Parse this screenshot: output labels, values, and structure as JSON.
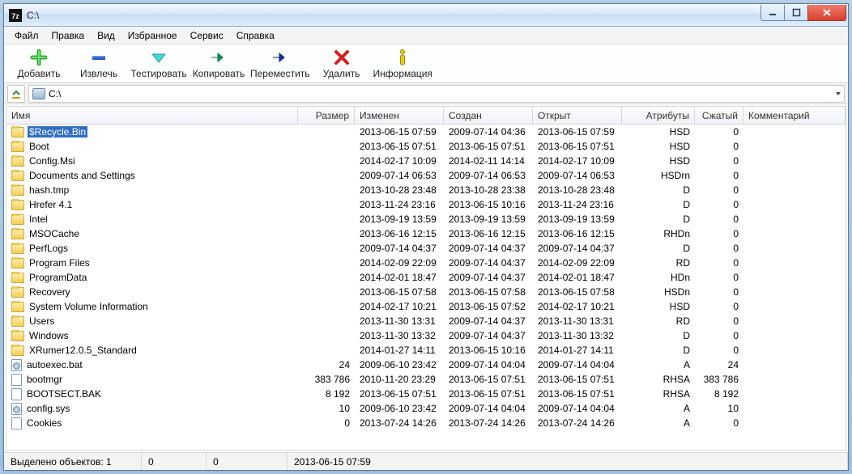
{
  "title": "C:\\",
  "menu": [
    "Файл",
    "Правка",
    "Вид",
    "Избранное",
    "Сервис",
    "Справка"
  ],
  "toolbar": [
    {
      "id": "add",
      "label": "Добавить"
    },
    {
      "id": "extract",
      "label": "Извлечь"
    },
    {
      "id": "test",
      "label": "Тестировать"
    },
    {
      "id": "copy",
      "label": "Копировать"
    },
    {
      "id": "move",
      "label": "Переместить"
    },
    {
      "id": "delete",
      "label": "Удалить"
    },
    {
      "id": "info",
      "label": "Информация"
    }
  ],
  "path": "C:\\",
  "columns": {
    "name": "Имя",
    "size": "Размер",
    "modified": "Изменен",
    "created": "Создан",
    "opened": "Открыт",
    "attr": "Атрибуты",
    "packed": "Сжатый",
    "comment": "Комментарий"
  },
  "rows": [
    {
      "t": "d",
      "sel": true,
      "n": "$Recycle.Bin",
      "s": "",
      "m": "2013-06-15 07:59",
      "c": "2009-07-14 04:36",
      "o": "2013-06-15 07:59",
      "a": "HSD",
      "p": "0"
    },
    {
      "t": "d",
      "n": "Boot",
      "s": "",
      "m": "2013-06-15 07:51",
      "c": "2013-06-15 07:51",
      "o": "2013-06-15 07:51",
      "a": "HSD",
      "p": "0"
    },
    {
      "t": "d",
      "n": "Config.Msi",
      "s": "",
      "m": "2014-02-17 10:09",
      "c": "2014-02-11 14:14",
      "o": "2014-02-17 10:09",
      "a": "HSD",
      "p": "0"
    },
    {
      "t": "d",
      "n": "Documents and Settings",
      "s": "",
      "m": "2009-07-14 06:53",
      "c": "2009-07-14 06:53",
      "o": "2009-07-14 06:53",
      "a": "HSDrn",
      "p": "0"
    },
    {
      "t": "d",
      "n": "hash.tmp",
      "s": "",
      "m": "2013-10-28 23:48",
      "c": "2013-10-28 23:38",
      "o": "2013-10-28 23:48",
      "a": "D",
      "p": "0"
    },
    {
      "t": "d",
      "n": "Hrefer 4.1",
      "s": "",
      "m": "2013-11-24 23:16",
      "c": "2013-06-15 10:16",
      "o": "2013-11-24 23:16",
      "a": "D",
      "p": "0"
    },
    {
      "t": "d",
      "n": "Intel",
      "s": "",
      "m": "2013-09-19 13:59",
      "c": "2013-09-19 13:59",
      "o": "2013-09-19 13:59",
      "a": "D",
      "p": "0"
    },
    {
      "t": "d",
      "n": "MSOCache",
      "s": "",
      "m": "2013-06-16 12:15",
      "c": "2013-06-16 12:15",
      "o": "2013-06-16 12:15",
      "a": "RHDn",
      "p": "0"
    },
    {
      "t": "d",
      "n": "PerfLogs",
      "s": "",
      "m": "2009-07-14 04:37",
      "c": "2009-07-14 04:37",
      "o": "2009-07-14 04:37",
      "a": "D",
      "p": "0"
    },
    {
      "t": "d",
      "n": "Program Files",
      "s": "",
      "m": "2014-02-09 22:09",
      "c": "2009-07-14 04:37",
      "o": "2014-02-09 22:09",
      "a": "RD",
      "p": "0"
    },
    {
      "t": "d",
      "n": "ProgramData",
      "s": "",
      "m": "2014-02-01 18:47",
      "c": "2009-07-14 04:37",
      "o": "2014-02-01 18:47",
      "a": "HDn",
      "p": "0"
    },
    {
      "t": "d",
      "n": "Recovery",
      "s": "",
      "m": "2013-06-15 07:58",
      "c": "2013-06-15 07:58",
      "o": "2013-06-15 07:58",
      "a": "HSDn",
      "p": "0"
    },
    {
      "t": "d",
      "n": "System Volume Information",
      "s": "",
      "m": "2014-02-17 10:21",
      "c": "2013-06-15 07:52",
      "o": "2014-02-17 10:21",
      "a": "HSD",
      "p": "0"
    },
    {
      "t": "d",
      "n": "Users",
      "s": "",
      "m": "2013-11-30 13:31",
      "c": "2009-07-14 04:37",
      "o": "2013-11-30 13:31",
      "a": "RD",
      "p": "0"
    },
    {
      "t": "d",
      "n": "Windows",
      "s": "",
      "m": "2013-11-30 13:32",
      "c": "2009-07-14 04:37",
      "o": "2013-11-30 13:32",
      "a": "D",
      "p": "0"
    },
    {
      "t": "d",
      "n": "XRumer12.0.5_Standard",
      "s": "",
      "m": "2014-01-27 14:11",
      "c": "2013-06-15 10:16",
      "o": "2014-01-27 14:11",
      "a": "D",
      "p": "0"
    },
    {
      "t": "fg",
      "n": "autoexec.bat",
      "s": "24",
      "m": "2009-06-10 23:42",
      "c": "2009-07-14 04:04",
      "o": "2009-07-14 04:04",
      "a": "A",
      "p": "24"
    },
    {
      "t": "f",
      "n": "bootmgr",
      "s": "383 786",
      "m": "2010-11-20 23:29",
      "c": "2013-06-15 07:51",
      "o": "2013-06-15 07:51",
      "a": "RHSA",
      "p": "383 786"
    },
    {
      "t": "f",
      "n": "BOOTSECT.BAK",
      "s": "8 192",
      "m": "2013-06-15 07:51",
      "c": "2013-06-15 07:51",
      "o": "2013-06-15 07:51",
      "a": "RHSA",
      "p": "8 192"
    },
    {
      "t": "fg",
      "n": "config.sys",
      "s": "10",
      "m": "2009-06-10 23:42",
      "c": "2009-07-14 04:04",
      "o": "2009-07-14 04:04",
      "a": "A",
      "p": "10"
    },
    {
      "t": "f",
      "n": "Cookies",
      "s": "0",
      "m": "2013-07-24 14:26",
      "c": "2013-07-24 14:26",
      "o": "2013-07-24 14:26",
      "a": "A",
      "p": "0"
    }
  ],
  "status": {
    "selected": "Выделено объектов: 1",
    "c2": "0",
    "c3": "0",
    "c4": "2013-06-15 07:59"
  }
}
